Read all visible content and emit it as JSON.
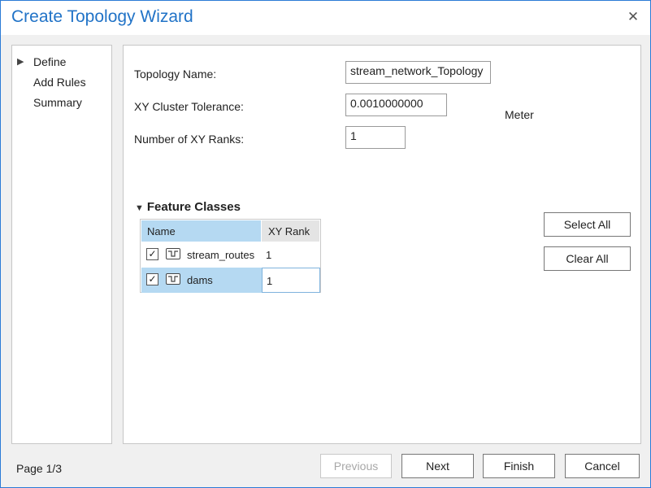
{
  "window": {
    "title": "Create Topology Wizard"
  },
  "nav": {
    "items": [
      {
        "label": "Define",
        "current": true
      },
      {
        "label": "Add Rules"
      },
      {
        "label": "Summary"
      }
    ]
  },
  "form": {
    "topology_name_label": "Topology Name:",
    "topology_name_value": "stream_network_Topology",
    "xy_cluster_label": "XY Cluster Tolerance:",
    "xy_cluster_value": "0.0010000000",
    "xy_cluster_unit": "Meter",
    "ranks_label": "Number of XY Ranks:",
    "ranks_value": "1"
  },
  "feature_classes": {
    "header": "Feature Classes",
    "columns": [
      "Name",
      "XY Rank"
    ],
    "rows": [
      {
        "name": "stream_routes",
        "checked": true,
        "rank": "1",
        "icon": "line-feature-icon"
      },
      {
        "name": "dams",
        "checked": true,
        "rank": "1",
        "icon": "line-feature-icon",
        "selected": true
      }
    ],
    "select_all_label": "Select All",
    "clear_all_label": "Clear All"
  },
  "footer": {
    "page_label": "Page 1/3",
    "previous_label": "Previous",
    "next_label": "Next",
    "finish_label": "Finish",
    "cancel_label": "Cancel"
  },
  "icons": {
    "close": "close-icon",
    "nav_current": "triangle-right-icon",
    "section_toggle": "chevron-down-icon",
    "checkbox_check": "check-icon"
  },
  "colors": {
    "title": "#2173c7",
    "selection": "#b5d9f2",
    "window_border": "#2b7bd6"
  }
}
